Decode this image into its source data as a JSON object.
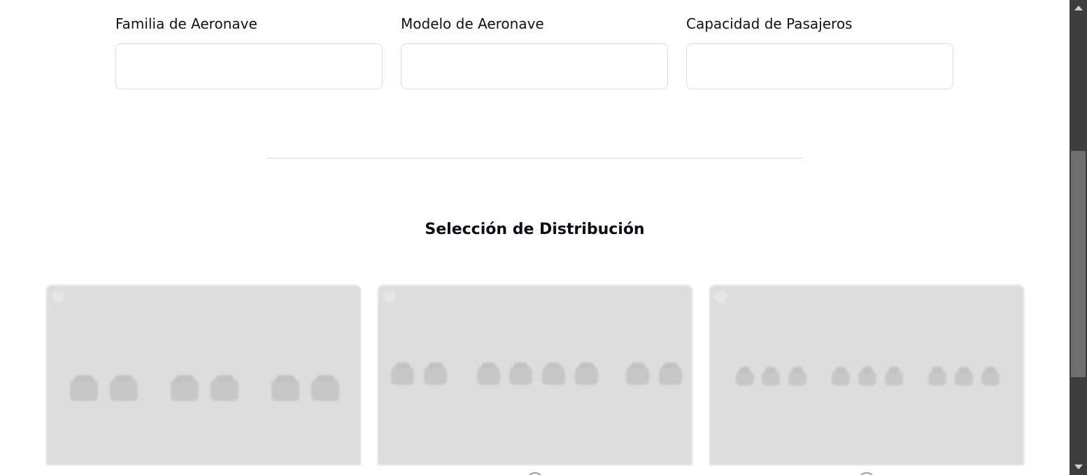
{
  "form": {
    "fields": [
      {
        "label": "Familia de Aeronave",
        "value": "",
        "placeholder": ""
      },
      {
        "label": "Modelo de Aeronave",
        "value": "",
        "placeholder": ""
      },
      {
        "label": "Capacidad de Pasajeros",
        "value": "",
        "placeholder": ""
      }
    ]
  },
  "distribution": {
    "title": "Selección de Distribución",
    "options": [
      {
        "seat_groups": [
          2,
          2,
          2
        ],
        "selected": false
      },
      {
        "seat_groups": [
          2,
          4,
          2
        ],
        "selected": false
      },
      {
        "seat_groups": [
          3,
          3,
          3
        ],
        "selected": false
      }
    ]
  },
  "colors": {
    "card_background": "#dddddd",
    "seat": "#c7c7c7",
    "scrollbar_track": "#3d3d3d",
    "scrollbar_thumb": "#6f6f6f"
  }
}
